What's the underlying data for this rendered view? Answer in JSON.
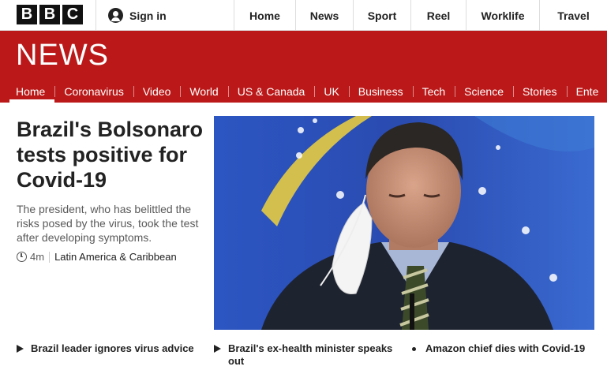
{
  "topbar": {
    "logo_letters": [
      "B",
      "B",
      "C"
    ],
    "signin": {
      "icon": "user-icon",
      "label": "Sign in"
    },
    "nav": [
      "Home",
      "News",
      "Sport",
      "Reel",
      "Worklife",
      "Travel"
    ]
  },
  "newsbar": {
    "title": "NEWS",
    "nav": [
      "Home",
      "Coronavirus",
      "Video",
      "World",
      "US & Canada",
      "UK",
      "Business",
      "Tech",
      "Science",
      "Stories",
      "Ente"
    ],
    "active_index": 0
  },
  "story": {
    "headline": "Brazil's Bolsonaro tests positive for Covid-19",
    "summary": "The president, who has belittled the risks posed by the virus, took the test after developing symptoms.",
    "time": "4m",
    "section": "Latin America & Caribbean"
  },
  "related": [
    {
      "icon": "play-icon",
      "text": "Brazil leader ignores virus advice"
    },
    {
      "icon": "play-icon",
      "text": "Brazil's ex-health minister speaks out"
    },
    {
      "icon": "bullet-icon",
      "text": "Amazon chief dies with Covid-19"
    }
  ],
  "colors": {
    "brand_red": "#bb1919",
    "text": "#222222",
    "muted": "#5a5a5a"
  }
}
